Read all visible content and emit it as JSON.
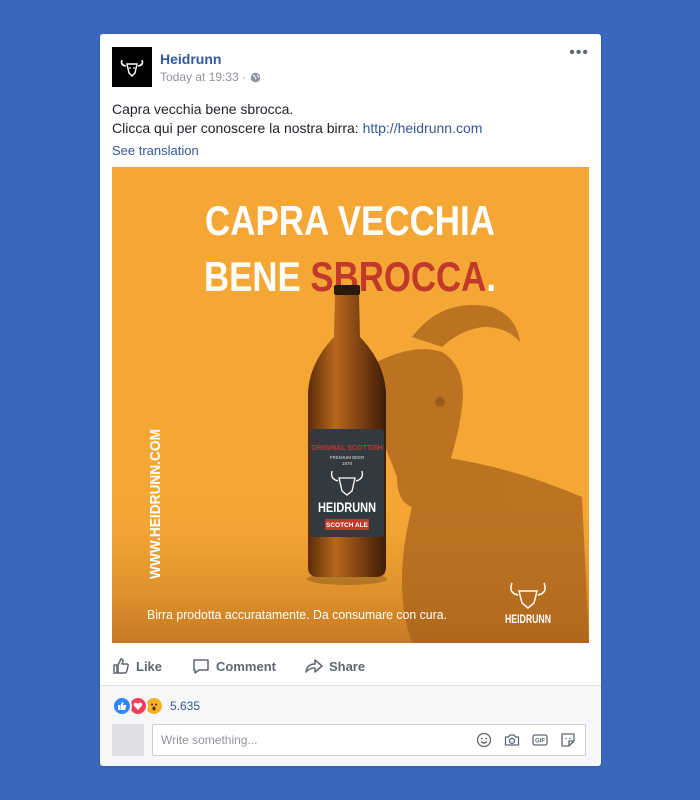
{
  "post": {
    "page_name": "Heidrunn",
    "timestamp": "Today at 19:33 ·",
    "audience_icon": "globe-icon",
    "more_label": "•••",
    "text_line1": "Capra vecchia bene sbrocca.",
    "text_line2_prefix": "Clicca qui per conoscere la nostra birra: ",
    "link": "http://heidrunn.com",
    "see_translation": "See translation"
  },
  "ad_image": {
    "headline_line1": "CAPRA VECCHIA",
    "headline_line2_a": "BENE ",
    "headline_line2_b": "SBROCCA",
    "headline_line2_c": ".",
    "vertical_url": "WWW.HEIDRUNN.COM",
    "tagline": "Birra prodotta accuratamente. Da consumare con cura.",
    "logo_text": "HEIDRUNN",
    "label_top": "ORIGINAL SCOTTISH",
    "label_sub": "PREMIUM BEER",
    "label_year": "1978",
    "label_brand": "HEIDRUNN",
    "label_style": "SCOTCH ALE",
    "colors": {
      "background": "#f5a735",
      "accent_red": "#c0392b",
      "bottle": "#8a4a14"
    }
  },
  "actions": {
    "like": "Like",
    "comment": "Comment",
    "share": "Share"
  },
  "reactions": {
    "count": "5.635",
    "types": [
      "like-icon",
      "love-icon",
      "wow-icon"
    ]
  },
  "comment": {
    "placeholder": "Write something...",
    "icons": [
      "emoji-icon",
      "camera-icon",
      "gif-icon",
      "sticker-icon"
    ],
    "gif_label": "GIF"
  },
  "colors": {
    "page_bg": "#3a67bd",
    "link": "#365899"
  }
}
